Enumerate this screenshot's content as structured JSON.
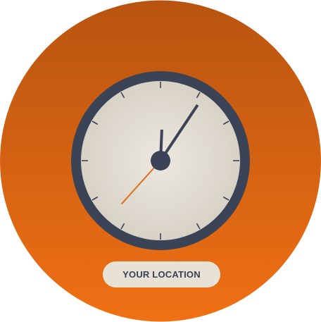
{
  "location_button": {
    "label": "YOUR LOCATION"
  },
  "clock": {
    "hour": 12,
    "minute": 5,
    "second": 37,
    "tick_count": 12
  },
  "colors": {
    "background_top": "#b85410",
    "background_bottom": "#f07014",
    "clock_rim": "#3b4357",
    "clock_face_center": "#ece8e0",
    "clock_face_edge": "#d8d2c6",
    "hands": "#3b4357",
    "second_hand": "#e06e20",
    "button_bg": "#e7e1d6",
    "button_text": "#3a4256"
  }
}
